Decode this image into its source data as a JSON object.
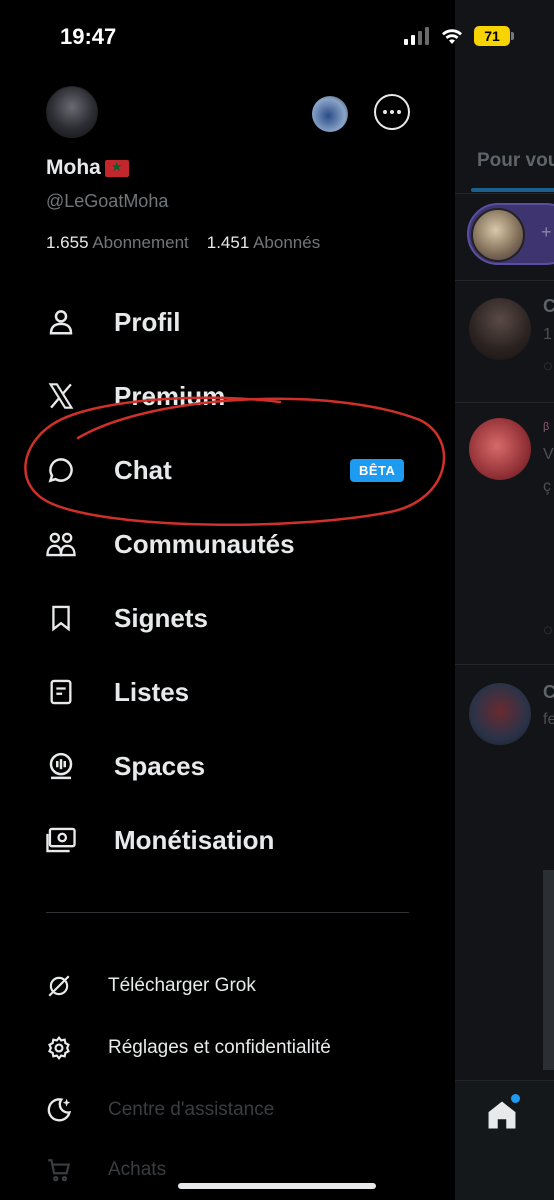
{
  "status_bar": {
    "time": "19:47",
    "battery": "71"
  },
  "profile": {
    "display_name": "Moha",
    "handle": "@LeGoatMoha",
    "following_count": "1.655",
    "following_label": "Abonnement",
    "followers_count": "1.451",
    "followers_label": "Abonnés"
  },
  "menu": [
    {
      "label": "Profil",
      "icon": "person-icon"
    },
    {
      "label": "Premium",
      "icon": "x-logo-icon"
    },
    {
      "label": "Chat",
      "icon": "chat-bubble-icon",
      "badge": "BÊTA"
    },
    {
      "label": "Communautés",
      "icon": "communities-icon"
    },
    {
      "label": "Signets",
      "icon": "bookmark-icon"
    },
    {
      "label": "Listes",
      "icon": "list-icon"
    },
    {
      "label": "Spaces",
      "icon": "spaces-icon"
    },
    {
      "label": "Monétisation",
      "icon": "money-icon"
    }
  ],
  "secondary": [
    {
      "label": "Télécharger Grok",
      "icon": "grok-icon"
    },
    {
      "label": "Réglages et confidentialité",
      "icon": "gear-icon"
    },
    {
      "label": "Centre d'assistance",
      "icon": "moon-icon"
    },
    {
      "label": "Achats",
      "icon": "cart-icon"
    }
  ],
  "timeline": {
    "tab": "Pour vous"
  },
  "colors": {
    "accent": "#1d9bf0",
    "annotation": "#d0302a",
    "battery": "#f7d400"
  }
}
